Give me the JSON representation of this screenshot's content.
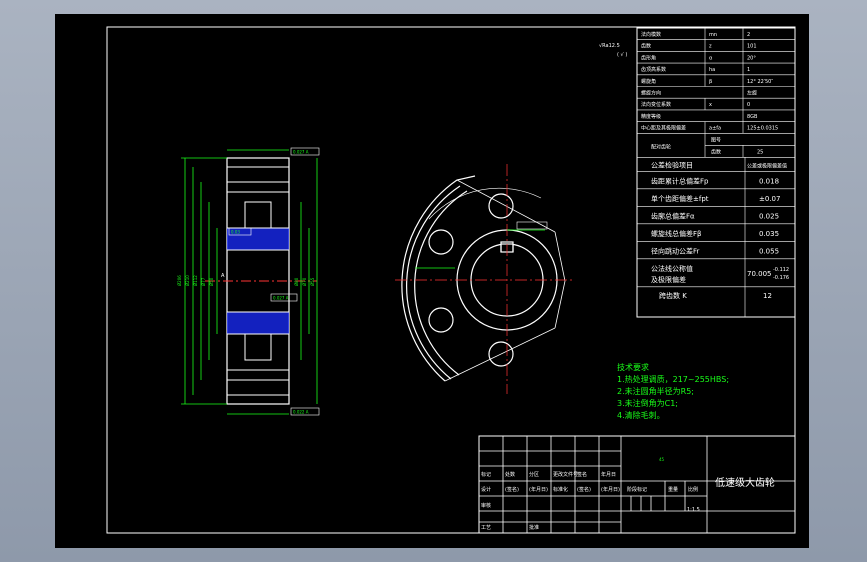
{
  "drawing": {
    "title": "低速级大齿轮",
    "roughness_mark": "√Ra12.5",
    "roughness_note": "( √ )",
    "scale": "1:1.5",
    "centre_mark": "45"
  },
  "gear_params": [
    {
      "name": "法向模数",
      "symbol": "mn",
      "value": "2"
    },
    {
      "name": "齿数",
      "symbol": "z",
      "value": "101"
    },
    {
      "name": "齿形角",
      "symbol": "α",
      "value": "20°"
    },
    {
      "name": "齿顶高系数",
      "symbol": "ha",
      "value": "1"
    },
    {
      "name": "螺旋角",
      "symbol": "β",
      "value": "12° 22′50″"
    },
    {
      "name": "螺旋方向",
      "symbol": "",
      "value": "左旋"
    },
    {
      "name": "法向变位系数",
      "symbol": "x",
      "value": "0"
    },
    {
      "name": "精度等级",
      "symbol": "",
      "value": "8GB"
    },
    {
      "name": "中心距及其极限偏差",
      "symbol": "a±fa",
      "value": "125±0.0315"
    }
  ],
  "mating_gear": {
    "label": "配对齿轮",
    "row1": "图号",
    "row2_label": "齿数",
    "row2_value": "25"
  },
  "tolerance_header": {
    "item": "公差检验项目",
    "value": "公差或极限偏差值"
  },
  "tolerances": [
    {
      "name": "齿距累计总偏差Fp",
      "value": "0.018"
    },
    {
      "name": "单个齿距偏差±fpt",
      "value": "±0.07"
    },
    {
      "name": "齿廓总偏差Fα",
      "value": "0.025"
    },
    {
      "name": "螺旋线总偏差Fβ",
      "value": "0.035"
    },
    {
      "name": "径向跳动公差Fr",
      "value": "0.055"
    }
  ],
  "span": {
    "label1": "公法线公称值",
    "label2": "及极限偏差",
    "value": "70.005",
    "upper": "-0.112",
    "lower": "-0.176"
  },
  "span_teeth": {
    "label": "跨齿数 K",
    "value": "12"
  },
  "tech_req": {
    "title": "技术要求",
    "items": [
      "1.热处理调质，217~255HBS;",
      "2.未注圆角半径为R5;",
      "3.未注倒角为C1;",
      "4.清除毛刺。"
    ]
  },
  "title_block": {
    "rows": [
      [
        "标记",
        "处数",
        "分区",
        "更改文件号",
        "签名",
        "年月日"
      ],
      [
        "设计",
        "(签名)",
        "(年月日)",
        "标准化",
        "(签名)",
        "(年月日)"
      ],
      [
        "审核",
        "",
        "",
        "",
        "",
        ""
      ],
      [
        "工艺",
        "",
        "批准",
        "",
        "",
        ""
      ]
    ],
    "stage_headers": [
      "阶段标记",
      "重量",
      "比例"
    ]
  },
  "dim_labels": [
    "Ø206",
    "Ø210",
    "Ø112",
    "Ø77",
    "Ø50",
    "Ø80",
    "Ø70",
    "Ø55"
  ],
  "section_label": "A",
  "tol_frames": [
    "0.027 A",
    "0.022 A",
    "0.027 A",
    "0.03"
  ]
}
